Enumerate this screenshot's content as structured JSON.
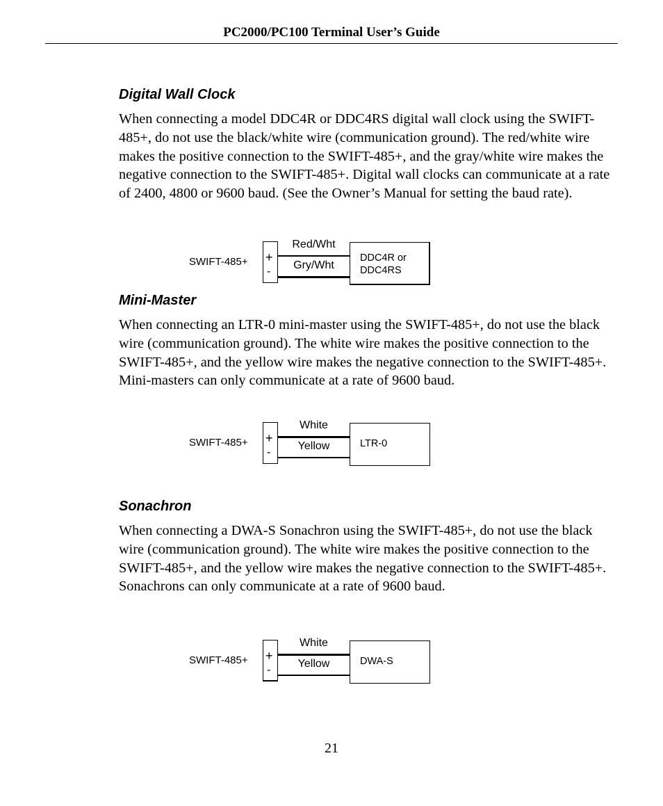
{
  "header": {
    "title": "PC2000/PC100 Terminal User’s Guide"
  },
  "sections": [
    {
      "heading": "Digital Wall Clock",
      "body": "When connecting a model DDC4R or DDC4RS digital wall clock using the SWIFT-485+, do not use the black/white wire (communication ground). The red/white wire makes the positive connection to the SWIFT-485+, and the gray/white wire makes the negative connection to the SWIFT-485+. Digital wall clocks can communicate at a rate of 2400, 4800 or 9600 baud. (See the Owner’s Manual for setting the baud rate).",
      "diagram": {
        "source": "SWIFT-485+",
        "plus": "+",
        "minus": "-",
        "wire_positive": "Red/Wht",
        "wire_negative": "Gry/Wht",
        "device": [
          "DDC4R or",
          "DDC4RS"
        ]
      }
    },
    {
      "heading": "Mini-Master",
      "body": "When connecting an LTR-0 mini-master using the SWIFT-485+, do not use the black wire (communication ground). The white wire makes the positive connection to the SWIFT-485+, and the yellow wire makes the negative connection to the SWIFT-485+. Mini-masters can only communicate at a rate of 9600 baud.",
      "diagram": {
        "source": "SWIFT-485+",
        "plus": "+",
        "minus": "-",
        "wire_positive": "White",
        "wire_negative": "Yellow",
        "device": [
          "LTR-0"
        ]
      }
    },
    {
      "heading": "Sonachron",
      "body": "When connecting a DWA-S Sonachron using the SWIFT-485+, do not use the black wire (communication ground). The white wire makes the positive connection to the SWIFT-485+, and the yellow wire makes the negative connection to the SWIFT-485+. Sonachrons can only communicate at a rate of 9600 baud.",
      "diagram": {
        "source": "SWIFT-485+",
        "plus": "+",
        "minus": "-",
        "wire_positive": "White",
        "wire_negative": "Yellow",
        "device": [
          "DWA-S"
        ]
      }
    }
  ],
  "footer": {
    "page_number": "21"
  }
}
